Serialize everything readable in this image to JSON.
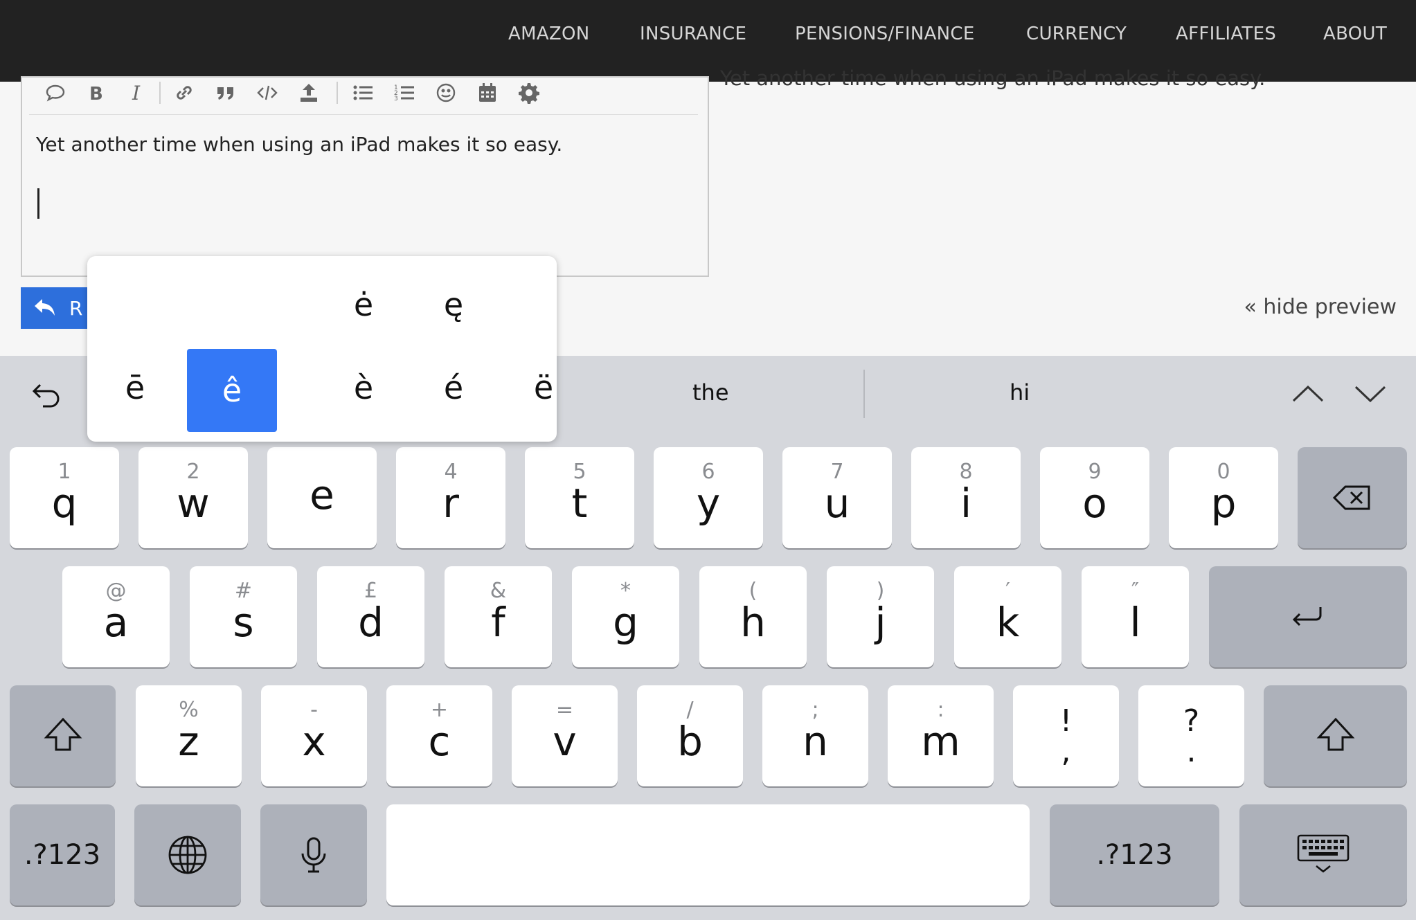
{
  "nav": {
    "items": [
      "AMAZON",
      "INSURANCE",
      "PENSIONS/FINANCE",
      "CURRENCY",
      "AFFILIATES",
      "ABOUT"
    ]
  },
  "preview": {
    "text_clipped": "Yet another time when using an iPad makes it so easy."
  },
  "editor": {
    "text": "Yet another time when using an iPad makes it so easy."
  },
  "reply_button": {
    "label": "R"
  },
  "hide_preview_label": "« hide preview",
  "keyboard": {
    "suggestions": [
      "the",
      "hi"
    ],
    "accent_popup": {
      "top_row": [
        "ė",
        "ę"
      ],
      "bottom_row": [
        "ē",
        "ê",
        "è",
        "é",
        "ë"
      ],
      "selected": "ê"
    },
    "row1": [
      {
        "hint": "1",
        "key": "q"
      },
      {
        "hint": "2",
        "key": "w"
      },
      {
        "hint": "",
        "key": "e"
      },
      {
        "hint": "4",
        "key": "r"
      },
      {
        "hint": "5",
        "key": "t"
      },
      {
        "hint": "6",
        "key": "y"
      },
      {
        "hint": "7",
        "key": "u"
      },
      {
        "hint": "8",
        "key": "i"
      },
      {
        "hint": "9",
        "key": "o"
      },
      {
        "hint": "0",
        "key": "p"
      }
    ],
    "row2": [
      {
        "hint": "@",
        "key": "a"
      },
      {
        "hint": "#",
        "key": "s"
      },
      {
        "hint": "£",
        "key": "d"
      },
      {
        "hint": "&",
        "key": "f"
      },
      {
        "hint": "*",
        "key": "g"
      },
      {
        "hint": "(",
        "key": "h"
      },
      {
        "hint": ")",
        "key": "j"
      },
      {
        "hint": "′",
        "key": "k"
      },
      {
        "hint": "″",
        "key": "l"
      }
    ],
    "row3": [
      {
        "hint": "%",
        "key": "z"
      },
      {
        "hint": "-",
        "key": "x"
      },
      {
        "hint": "+",
        "key": "c"
      },
      {
        "hint": "=",
        "key": "v"
      },
      {
        "hint": "/",
        "key": "b"
      },
      {
        "hint": ";",
        "key": "n"
      },
      {
        "hint": ":",
        "key": "m"
      }
    ],
    "punct": [
      {
        "top": "!",
        "bottom": ","
      },
      {
        "top": "?",
        "bottom": "."
      }
    ],
    "numbers_label": ".?123"
  },
  "colors": {
    "nav_bg": "#222222",
    "accent_selected": "#3478f6",
    "reply_button": "#2d6fdc",
    "keyboard_bg": "#d5d7dc"
  }
}
